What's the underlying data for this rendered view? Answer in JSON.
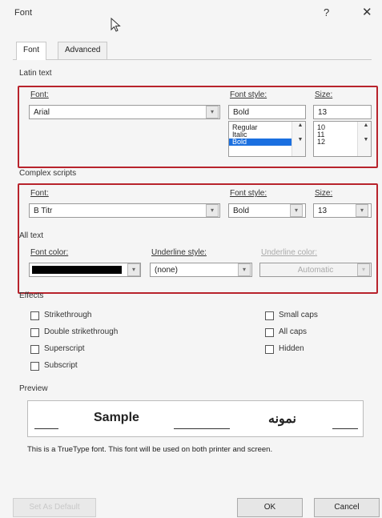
{
  "window": {
    "title": "Font",
    "help": "?",
    "close": "✕"
  },
  "tabs": [
    {
      "label": "Font"
    },
    {
      "label": "Advanced"
    }
  ],
  "latin": {
    "section": "Latin text",
    "font_label": "Font:",
    "font_value": "Arial",
    "style_label": "Font style:",
    "style_value": "Bold",
    "style_options": [
      "Regular",
      "Italic",
      "Bold"
    ],
    "size_label": "Size:",
    "size_value": "13",
    "size_options": [
      "10",
      "11",
      "12"
    ]
  },
  "complex": {
    "section": "Complex scripts",
    "font_label": "Font:",
    "font_value": "B Titr",
    "style_label": "Font style:",
    "style_value": "Bold",
    "size_label": "Size:",
    "size_value": "13"
  },
  "alltext": {
    "section": "All text",
    "color_label": "Font color:",
    "underline_label": "Underline style:",
    "underline_value": "(none)",
    "ucolor_label": "Underline color:",
    "ucolor_value": "Automatic"
  },
  "effects": {
    "section": "Effects",
    "left": [
      "Strikethrough",
      "Double strikethrough",
      "Superscript",
      "Subscript"
    ],
    "right": [
      "Small caps",
      "All caps",
      "Hidden"
    ]
  },
  "preview": {
    "section": "Preview",
    "sample": "Sample",
    "sample_arabic": "نمونه",
    "note": "This is a TrueType font. This font will be used on both printer and screen."
  },
  "buttons": {
    "default": "Set As Default",
    "ok": "OK",
    "cancel": "Cancel"
  },
  "colors": {
    "highlight": "#b8232c",
    "selection": "#1a6fe0"
  }
}
